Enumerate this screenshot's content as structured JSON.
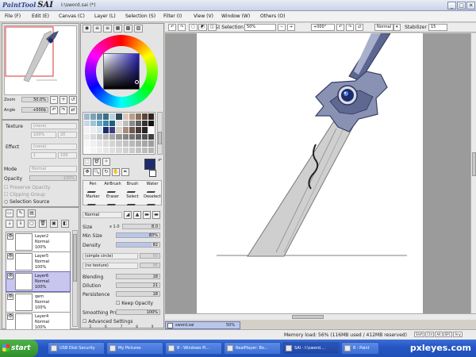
{
  "app": {
    "logo_small": "PaintTool",
    "logo_big": "SAI",
    "document_title": "I:\\sword.sai (*)"
  },
  "window_buttons": [
    "_",
    "□",
    "✕"
  ],
  "menu": [
    "File (F)",
    "Edit (E)",
    "Canvas (C)",
    "Layer (L)",
    "Selection (S)",
    "Filter (I)",
    "View (V)",
    "Window (W)",
    "Others (O)"
  ],
  "navigator": {
    "zoom_label": "Zoom",
    "zoom_value": "50.0%",
    "angle_label": "Angle",
    "angle_value": "+000$"
  },
  "properties": {
    "texture_label": "Texture",
    "texture_value": "(none)",
    "scale_value": "100%",
    "scale_num": "20",
    "effect_label": "Effect",
    "effect_value": "(none)",
    "width_value": "1",
    "width_num": "100",
    "mode_label": "Mode",
    "mode_value": "Normal",
    "opacity_label": "Opacity",
    "opacity_value": "100%",
    "preserve_opacity": "Preserve Opacity",
    "clipping_group": "Clipping Group",
    "selection_source": "Selection Source"
  },
  "layers": [
    {
      "name": "Layer2",
      "mode": "Normal",
      "opacity": "100%",
      "selected": false
    },
    {
      "name": "Layer5",
      "mode": "Normal",
      "opacity": "100%",
      "selected": false
    },
    {
      "name": "Layer6",
      "mode": "Normal",
      "opacity": "100%",
      "selected": true
    },
    {
      "name": "qem",
      "mode": "Normal",
      "opacity": "100%",
      "selected": false
    },
    {
      "name": "Layer4",
      "mode": "Normal",
      "opacity": "100%",
      "selected": false
    }
  ],
  "brushes": {
    "row1": [
      "Pen",
      "AirBrush",
      "Brush",
      "Water"
    ],
    "row2": [
      "Marker",
      "Eraser",
      "Select",
      "Deselect"
    ]
  },
  "brush_settings": {
    "mode": "Normal",
    "size_label": "Size",
    "size_mult": "x 1.0",
    "size_value": "8.0",
    "min_size_label": "Min Size",
    "min_size_value": "83%",
    "min_size_fraction": 0.83,
    "density_label": "Density",
    "density_value": "82",
    "density_fraction": 0.82,
    "shape_value": "(simple circle)",
    "shape_num": "50",
    "texture_value": "(no texture)",
    "texture_num": "95",
    "blending_label": "Blending",
    "blending_value": "18",
    "dilution_label": "Dilution",
    "dilution_value": "21",
    "persistence_label": "Persistence",
    "persistence_value": "18",
    "keep_opacity": "Keep Opacity",
    "smoothing_label": "Smoothing Prs",
    "smoothing_value": "100%",
    "advanced_settings": "Advanced Settings",
    "stabilizer_ticks": [
      "5",
      "6",
      "7",
      "8",
      "9"
    ]
  },
  "canvas_toolbar": {
    "selection_label": "Selection",
    "zoom_value": "50%",
    "angle_value": "+000°",
    "mode_value": "Normal",
    "stabilizer_label": "Stabilizer",
    "stabilizer_value": "15"
  },
  "document_tab": {
    "name": "sword.sai",
    "zoom": "50%"
  },
  "status": {
    "memory": "Memory load: 56% (116MB used / 412MB reserved)",
    "keys": [
      "Shift",
      "Ctrl",
      "Alt",
      "SPC",
      "Any"
    ]
  },
  "taskbar": {
    "start": "start",
    "tasks": [
      "USB Disk Security",
      "My Pictures",
      "8 - Windows Pi...",
      "RealPlayer: Bo...",
      "SAI - I:\\sword....",
      "8 - Paint"
    ],
    "watermark": "pxleyes.com"
  },
  "colors": {
    "accent_blue": "#2f4a90",
    "selected_layer": "#c8c6ef",
    "current_color": "#1d2c6e",
    "taskbar": "#2556c4",
    "start_green": "#3c9a36"
  }
}
